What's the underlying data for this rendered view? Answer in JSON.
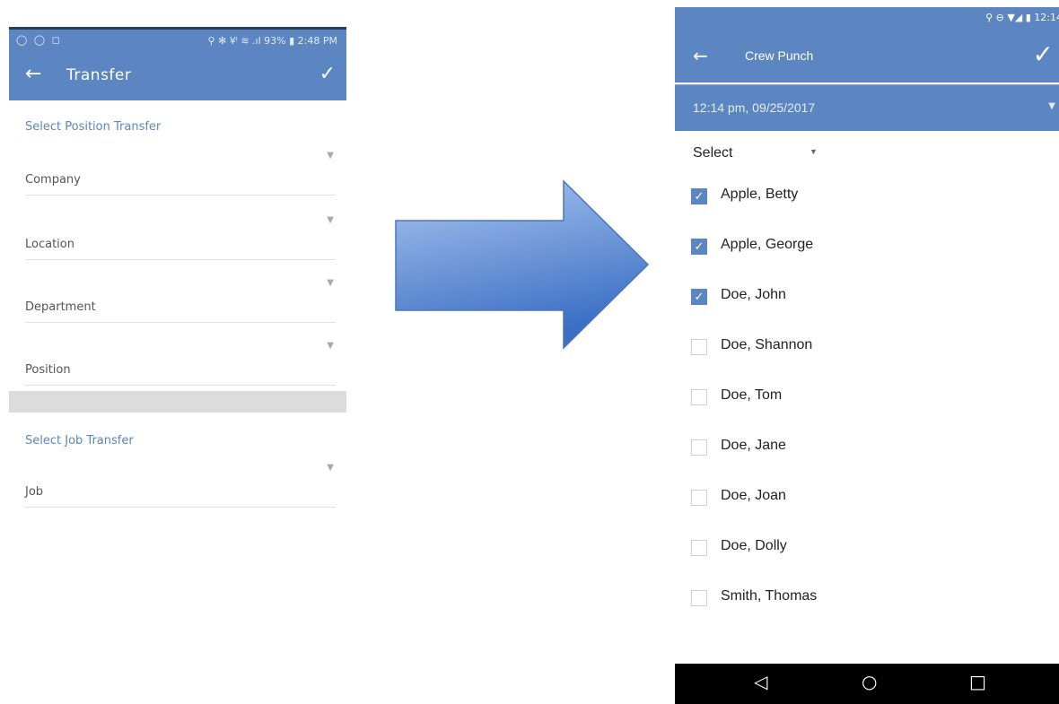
{
  "left": {
    "status": {
      "left": "◯ ◯ ◻",
      "right": "⚲ ✻ ¥ᴵ ≋ .ıl 93% ▮ 2:48 PM"
    },
    "toolbar": {
      "title": "Transfer"
    },
    "position_section": {
      "heading": "Select Position Transfer",
      "fields": [
        "Company",
        "Location",
        "Department",
        "Position"
      ]
    },
    "job_section": {
      "heading": "Select Job Transfer",
      "fields": [
        "Job"
      ]
    }
  },
  "right": {
    "status": {
      "time": "12:14"
    },
    "toolbar": {
      "title": "Crew Punch"
    },
    "datetime": "12:14 pm, 09/25/2017",
    "select_label": "Select",
    "employees": [
      {
        "name": "Apple, Betty",
        "checked": true
      },
      {
        "name": "Apple, George",
        "checked": true
      },
      {
        "name": "Doe, John",
        "checked": true
      },
      {
        "name": "Doe, Shannon",
        "checked": false
      },
      {
        "name": "Doe, Tom",
        "checked": false
      },
      {
        "name": "Doe, Jane",
        "checked": false
      },
      {
        "name": "Doe, Joan",
        "checked": false
      },
      {
        "name": "Doe, Dolly",
        "checked": false
      },
      {
        "name": "Smith, Thomas",
        "checked": false
      }
    ]
  },
  "colors": {
    "accent": "#5b86c1",
    "arrow_light": "#a9c5f0",
    "arrow_dark": "#3b6fc4"
  }
}
